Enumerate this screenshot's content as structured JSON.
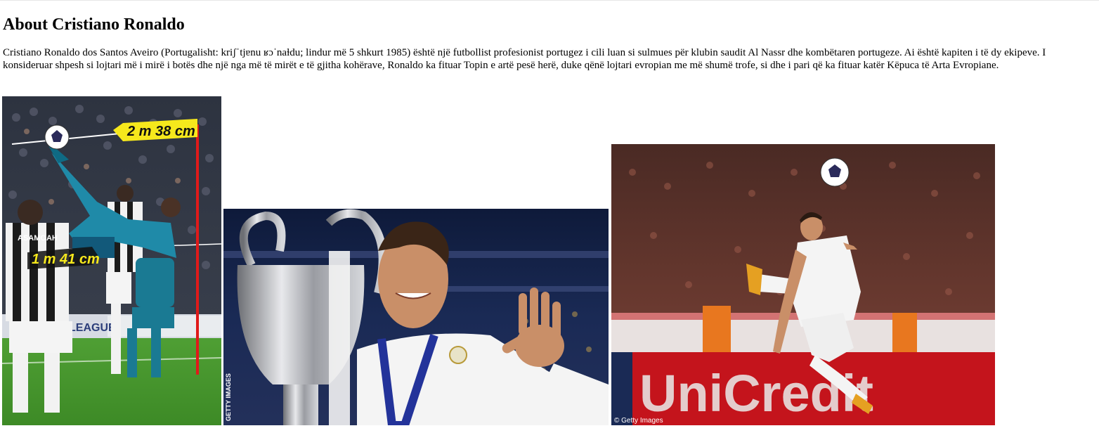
{
  "page": {
    "heading": "About Cristiano Ronaldo",
    "bio": "Cristiano Ronaldo dos Santos Aveiro (Portugalisht: kriʃˈtjɐnu ʁɔˈnaɫdu; lindur më 5 shkurt 1985) është një futbollist profesionist portugez i cili luan si sulmues për klubin saudit Al Nassr dhe kombëtaren portugeze. Ai është kapiten i të dy ekipeve. I konsideruar shpesh si lojtari më i mirë i botës dhe një nga më të mirët e të gjitha kohërave, Ronaldo ka fituar Topin e artë pesë herë, duke qënë lojtari evropian me më shumë trofe, si dhe i pari që ka fituar katër Këpuca të Arta Evropiane."
  },
  "photos": {
    "bicycle_kick": {
      "height_label_top": "2 m 38 cm",
      "height_label_bottom": "1 m 41 cm",
      "shirt_sponsor": "ASAMOAH",
      "board_text": "LEAGUE"
    },
    "trophy": {
      "credit": "GETTY IMAGES"
    },
    "volley": {
      "credit": "© Getty Images",
      "board_text": "UniCredit"
    }
  },
  "colors": {
    "label_yellow": "#f6e81c",
    "real_white": "#f4f4f4",
    "pitch_green": "#4a9a2c",
    "juve_black": "#1b1b1b",
    "board_red": "#c4141c"
  }
}
